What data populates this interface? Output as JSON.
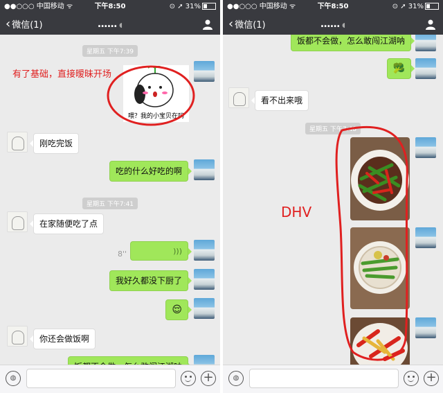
{
  "status_bar": {
    "carrier": "●●○○○ 中国移动 ᯤ",
    "time": "下午8:50",
    "battery": "⊙ ➚ 31%"
  },
  "nav": {
    "back_label": "微信(1)",
    "back_chevron": "‹",
    "title": "……",
    "title_icon": "ear-icon"
  },
  "left_chat": {
    "timestamp1": "星期五 下午7:39",
    "annotation1": "有了基础，直接暧昧开场",
    "sticker_caption": "喂？我的小宝贝在吗",
    "msg1": "刚吃完饭",
    "msg2": "吃的什么好吃的啊",
    "timestamp2": "星期五 下午7:41",
    "msg3": "在家随便吃了点",
    "voice_duration": "8''",
    "voice_glyph": ")))",
    "msg4": "我好久都没下厨了",
    "emoji_msg": "😌",
    "msg5": "你还会做饭啊",
    "msg6": "饭都不会做，怎么敢闯江湖呐"
  },
  "right_chat": {
    "msg1": "饭都不会做，怎么敢闯江湖呐",
    "emoji_msg": "🥦",
    "msg2": "看不出来哦",
    "timestamp": "星期五 下午7:48",
    "annotation": "DHV"
  },
  "input_bar": {
    "voice_glyph": "◍",
    "plus_glyph": "+"
  },
  "colors": {
    "nav_bg": "#393a3f",
    "chat_bg": "#ebebeb",
    "bubble_green": "#a0e75a",
    "annotation_red": "#e02020"
  }
}
